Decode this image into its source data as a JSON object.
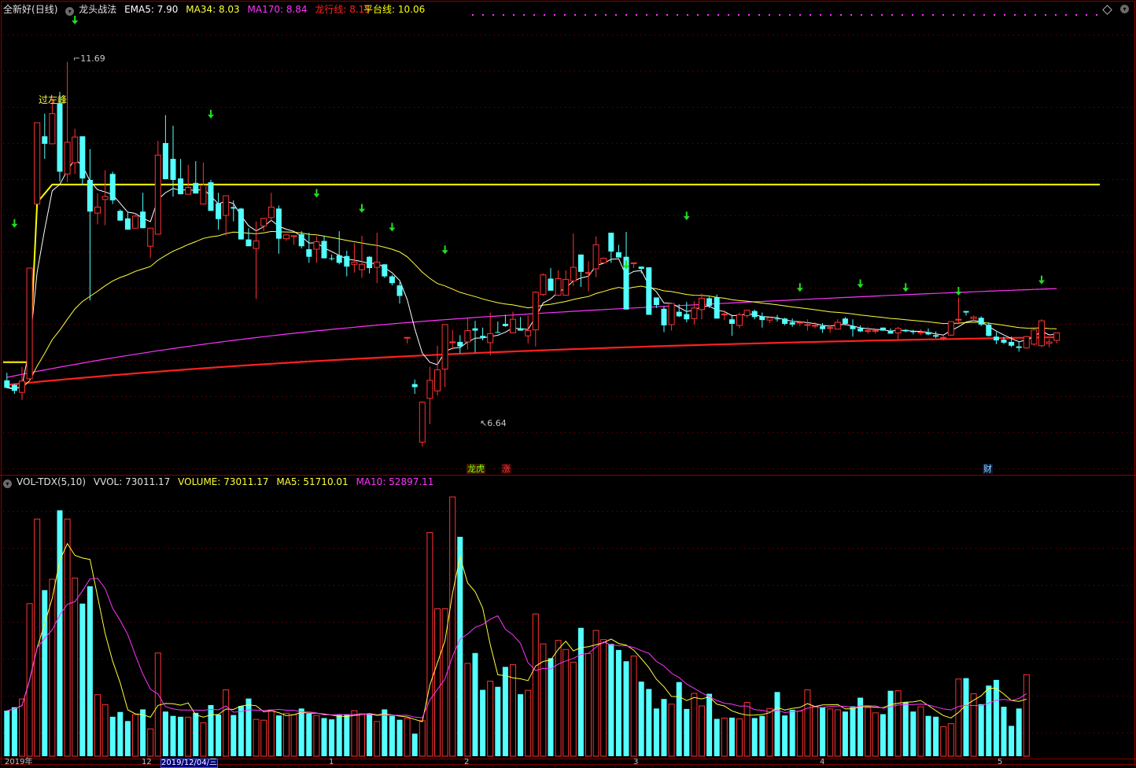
{
  "main_header": {
    "stock_name": "全新好",
    "period": "(日线)",
    "indicator_name": "龙头战法",
    "ema5": "EMA5: 7.90",
    "ma34": "MA34: 8.03",
    "ma170": "MA170: 8.84",
    "dragon_line": "龙行线: 8.15",
    "platform_line": "平台线: 10.06"
  },
  "vol_header": {
    "name": "VOL-TDX(5,10)",
    "vvol": "VVOL: 73011.17",
    "volume": "VOLUME: 73011.17",
    "ma5": "MA5: 51710.01",
    "ma10": "MA10: 52897.11"
  },
  "annotations": {
    "high_label": "11.69",
    "low_label": "6.64",
    "breakout_label": "过左峰",
    "marker_longhu": "龙虎",
    "marker_zhang": "涨",
    "marker_cai": "财"
  },
  "time_axis": {
    "labels": [
      "2019年",
      "12",
      "2019/12/04/三",
      "1",
      "2",
      "3",
      "4",
      "5"
    ]
  },
  "colors": {
    "up": "#ff3232",
    "down": "#54ffff",
    "ema5": "#ffffff",
    "ma34": "#ffff3c",
    "ma170": "#ff33ff",
    "dragon_line": "#ff2020",
    "platform_line": "#ffff00",
    "arrow": "#22dd22",
    "grid": "#8b0000"
  },
  "chart_data": {
    "type": "candlestick",
    "price_range": [
      6.3,
      12.3
    ],
    "platform_line_value": 10.06,
    "candles": [
      [
        7.46,
        7.56,
        7.36,
        7.36
      ],
      [
        7.4,
        7.41,
        7.28,
        7.32
      ],
      [
        7.3,
        7.64,
        7.2,
        7.45
      ],
      [
        7.48,
        8.95,
        7.45,
        8.95
      ],
      [
        9.8,
        10.88,
        9.8,
        10.88
      ],
      [
        10.7,
        11.0,
        10.4,
        10.6
      ],
      [
        10.6,
        11.2,
        10.6,
        11.0
      ],
      [
        11.14,
        11.29,
        10.1,
        10.23
      ],
      [
        10.2,
        11.69,
        10.09,
        10.62
      ],
      [
        10.35,
        10.8,
        10.2,
        10.69
      ],
      [
        10.7,
        10.7,
        10.05,
        10.14
      ],
      [
        10.12,
        10.53,
        8.52,
        9.7
      ],
      [
        9.68,
        9.94,
        9.53,
        9.76
      ],
      [
        9.86,
        10.25,
        9.52,
        9.9
      ],
      [
        10.2,
        10.23,
        9.8,
        9.85
      ],
      [
        9.71,
        9.73,
        9.58,
        9.58
      ],
      [
        9.61,
        9.7,
        9.48,
        9.46
      ],
      [
        9.48,
        9.68,
        9.48,
        9.64
      ],
      [
        9.7,
        9.95,
        9.48,
        9.48
      ],
      [
        9.24,
        9.48,
        9.08,
        9.48
      ],
      [
        9.4,
        10.64,
        9.4,
        10.45
      ],
      [
        10.61,
        10.98,
        10.26,
        10.13
      ],
      [
        10.4,
        10.84,
        9.9,
        10.12
      ],
      [
        10.14,
        10.4,
        9.94,
        9.93
      ],
      [
        9.93,
        10.32,
        9.97,
        10.02
      ],
      [
        10.08,
        10.37,
        9.94,
        9.94
      ],
      [
        9.8,
        10.35,
        9.8,
        10.05
      ],
      [
        10.09,
        10.12,
        9.71,
        9.71
      ],
      [
        9.81,
        9.95,
        9.46,
        9.6
      ],
      [
        9.65,
        9.88,
        9.38,
        9.91
      ],
      [
        9.76,
        9.85,
        9.57,
        9.74
      ],
      [
        9.74,
        9.75,
        9.35,
        9.33
      ],
      [
        9.33,
        9.48,
        9.33,
        9.24
      ],
      [
        9.21,
        9.57,
        8.54,
        9.31
      ],
      [
        9.51,
        9.59,
        9.44,
        9.61
      ],
      [
        9.62,
        9.95,
        9.57,
        9.76
      ],
      [
        9.74,
        9.78,
        9.14,
        9.34
      ],
      [
        9.34,
        9.4,
        9.31,
        9.39
      ],
      [
        9.37,
        9.37,
        9.26,
        9.38
      ],
      [
        9.4,
        9.44,
        9.21,
        9.24
      ],
      [
        9.2,
        9.42,
        9.02,
        9.1
      ],
      [
        9.2,
        9.37,
        9.02,
        9.3
      ],
      [
        9.31,
        9.38,
        9.12,
        9.08
      ],
      [
        9.08,
        9.13,
        9.05,
        9.07
      ],
      [
        9.12,
        9.44,
        9.0,
        9.02
      ],
      [
        9.11,
        9.18,
        8.84,
        8.97
      ],
      [
        9.0,
        9.28,
        8.89,
        9.03
      ],
      [
        8.93,
        9.38,
        8.82,
        9.0
      ],
      [
        9.1,
        9.11,
        8.88,
        8.95
      ],
      [
        8.96,
        9.42,
        8.75,
        9.03
      ],
      [
        9.0,
        9.0,
        8.82,
        8.84
      ],
      [
        8.84,
        8.86,
        8.72,
        8.75
      ],
      [
        8.72,
        8.76,
        8.48,
        8.58
      ],
      [
        8.03,
        8.03,
        7.95,
        8.03
      ],
      [
        7.41,
        7.47,
        7.28,
        7.37
      ],
      [
        6.64,
        7.18,
        6.58,
        7.17
      ],
      [
        7.22,
        7.64,
        6.88,
        7.46
      ],
      [
        7.32,
        7.92,
        7.26,
        7.6
      ],
      [
        7.61,
        8.2,
        7.37,
        8.2
      ],
      [
        7.97,
        8.13,
        7.87,
        7.97
      ],
      [
        7.97,
        8.06,
        7.82,
        7.91
      ],
      [
        7.97,
        8.28,
        7.87,
        8.12
      ],
      [
        8.15,
        8.25,
        7.83,
        8.12
      ],
      [
        8.05,
        8.16,
        7.99,
        8.03
      ],
      [
        7.96,
        8.36,
        7.79,
        8.08
      ],
      [
        8.1,
        8.24,
        8.09,
        8.09
      ],
      [
        8.21,
        8.33,
        8.17,
        8.18
      ],
      [
        8.09,
        8.37,
        8.16,
        8.27
      ],
      [
        8.15,
        8.3,
        8.13,
        8.12
      ],
      [
        8.05,
        8.32,
        7.95,
        8.12
      ],
      [
        8.13,
        8.64,
        7.91,
        8.63
      ],
      [
        8.6,
        8.88,
        8.58,
        8.86
      ],
      [
        8.81,
        8.95,
        8.65,
        8.65
      ],
      [
        8.59,
        8.92,
        8.58,
        8.81
      ],
      [
        8.59,
        8.92,
        8.62,
        8.8
      ],
      [
        8.78,
        9.41,
        8.71,
        8.96
      ],
      [
        9.13,
        9.13,
        8.7,
        8.9
      ],
      [
        8.88,
        9.04,
        8.64,
        8.89
      ],
      [
        8.94,
        9.37,
        8.83,
        9.26
      ],
      [
        9.02,
        9.09,
        9.03,
        9.08
      ],
      [
        9.42,
        9.41,
        9.02,
        9.17
      ],
      [
        9.16,
        9.26,
        9.36,
        9.09
      ],
      [
        9.1,
        9.43,
        8.7,
        8.4
      ],
      [
        9.02,
        9.02,
        8.95,
        9.02
      ],
      [
        8.97,
        8.95,
        8.88,
        8.94
      ],
      [
        8.96,
        8.2,
        8.93,
        8.33
      ],
      [
        8.56,
        8.56,
        8.42,
        8.46
      ],
      [
        8.41,
        8.44,
        8.1,
        8.19
      ],
      [
        8.2,
        8.48,
        8.12,
        8.48
      ],
      [
        8.37,
        8.47,
        8.3,
        8.31
      ],
      [
        8.34,
        8.5,
        8.23,
        8.27
      ],
      [
        8.28,
        8.51,
        8.2,
        8.42
      ],
      [
        8.4,
        8.61,
        8.27,
        8.55
      ],
      [
        8.55,
        8.57,
        8.42,
        8.45
      ],
      [
        8.56,
        8.6,
        8.28,
        8.28
      ],
      [
        8.33,
        8.39,
        8.26,
        8.34
      ],
      [
        8.27,
        8.33,
        8.05,
        8.21
      ],
      [
        8.19,
        8.36,
        8.15,
        8.33
      ],
      [
        8.32,
        8.39,
        8.29,
        8.39
      ],
      [
        8.38,
        8.4,
        8.27,
        8.3
      ],
      [
        8.31,
        8.36,
        8.16,
        8.26
      ],
      [
        8.26,
        8.31,
        8.22,
        8.29
      ],
      [
        8.28,
        8.33,
        8.24,
        8.27
      ],
      [
        8.28,
        8.29,
        8.19,
        8.21
      ],
      [
        8.23,
        8.28,
        8.17,
        8.2
      ],
      [
        8.23,
        8.25,
        8.18,
        8.23
      ],
      [
        8.2,
        8.27,
        8.12,
        8.2
      ],
      [
        8.19,
        8.23,
        8.15,
        8.19
      ],
      [
        8.18,
        8.22,
        8.09,
        8.14
      ],
      [
        8.15,
        8.19,
        8.09,
        8.16
      ],
      [
        8.14,
        8.27,
        8.14,
        8.23
      ],
      [
        8.28,
        8.3,
        8.19,
        8.21
      ],
      [
        8.18,
        8.27,
        8.04,
        8.14
      ],
      [
        8.15,
        8.19,
        8.1,
        8.11
      ],
      [
        8.12,
        8.17,
        8.08,
        8.12
      ],
      [
        8.11,
        8.13,
        8.08,
        8.12
      ],
      [
        8.16,
        8.16,
        8.12,
        8.12
      ],
      [
        8.12,
        8.15,
        8.08,
        8.08
      ],
      [
        8.09,
        8.17,
        8.0,
        8.15
      ],
      [
        8.13,
        8.14,
        8.1,
        8.11
      ],
      [
        8.11,
        8.13,
        8.07,
        8.1
      ],
      [
        8.1,
        8.14,
        8.06,
        8.1
      ],
      [
        8.1,
        8.15,
        8.06,
        8.07
      ],
      [
        8.06,
        8.11,
        8.02,
        8.04
      ],
      [
        8.02,
        8.06,
        7.99,
        8.03
      ],
      [
        8.06,
        8.24,
        8.05,
        8.24
      ],
      [
        8.27,
        8.56,
        8.22,
        8.27
      ],
      [
        8.38,
        8.38,
        8.32,
        8.36
      ],
      [
        8.28,
        8.32,
        8.25,
        8.3
      ],
      [
        8.29,
        8.31,
        8.18,
        8.2
      ],
      [
        8.2,
        8.23,
        8.04,
        8.05
      ],
      [
        8.04,
        8.1,
        7.94,
        7.99
      ],
      [
        8.0,
        8.04,
        7.94,
        7.96
      ],
      [
        7.97,
        8.04,
        7.9,
        7.92
      ],
      [
        7.91,
        7.98,
        7.84,
        7.89
      ],
      [
        7.89,
        8.05,
        7.88,
        8.04
      ],
      [
        7.94,
        8.14,
        7.92,
        8.13
      ],
      [
        7.92,
        8.27,
        7.9,
        8.25
      ],
      [
        7.95,
        8.01,
        7.9,
        7.97
      ],
      [
        7.99,
        8.06,
        7.95,
        8.09
      ]
    ],
    "volume_values": [
      10500,
      11300,
      13200,
      35200,
      54700,
      38300,
      40800,
      56700,
      54700,
      41100,
      35200,
      39200,
      14200,
      11900,
      9100,
      10200,
      8100,
      9600,
      10800,
      6300,
      23800,
      10300,
      9300,
      9100,
      9000,
      10000,
      7700,
      11800,
      9600,
      15300,
      9500,
      11600,
      13300,
      8500,
      8300,
      10700,
      9400,
      9900,
      9600,
      11000,
      9800,
      9400,
      8800,
      8500,
      9500,
      9700,
      10500,
      9800,
      9700,
      8000,
      10800,
      9300,
      8400,
      8700,
      5200,
      8200,
      51600,
      34000,
      34000,
      59800,
      50600,
      21400,
      23800,
      15300,
      17300,
      16000,
      20600,
      21100,
      14300,
      15200,
      32800,
      25900,
      22600,
      26700,
      24600,
      21700,
      29600,
      23700,
      29000,
      26900,
      25900,
      24500,
      21900,
      23100,
      17200,
      15500,
      11000,
      13200,
      12000,
      17100,
      10900,
      14500,
      11600,
      14400,
      8600,
      8800,
      8900,
      8600,
      12400,
      8800,
      9300,
      11000,
      14800,
      9400,
      10700,
      10400,
      15300,
      11500,
      11200,
      10900,
      10700,
      10300,
      11500,
      13500,
      11200,
      10000,
      9700,
      15100,
      15100,
      12400,
      10300,
      11400,
      9300,
      9100,
      6800,
      7500,
      17800,
      18000,
      14400,
      12000,
      16300,
      17600,
      11400,
      7000,
      11000,
      18800
    ],
    "volume_range": [
      0,
      62000
    ]
  }
}
